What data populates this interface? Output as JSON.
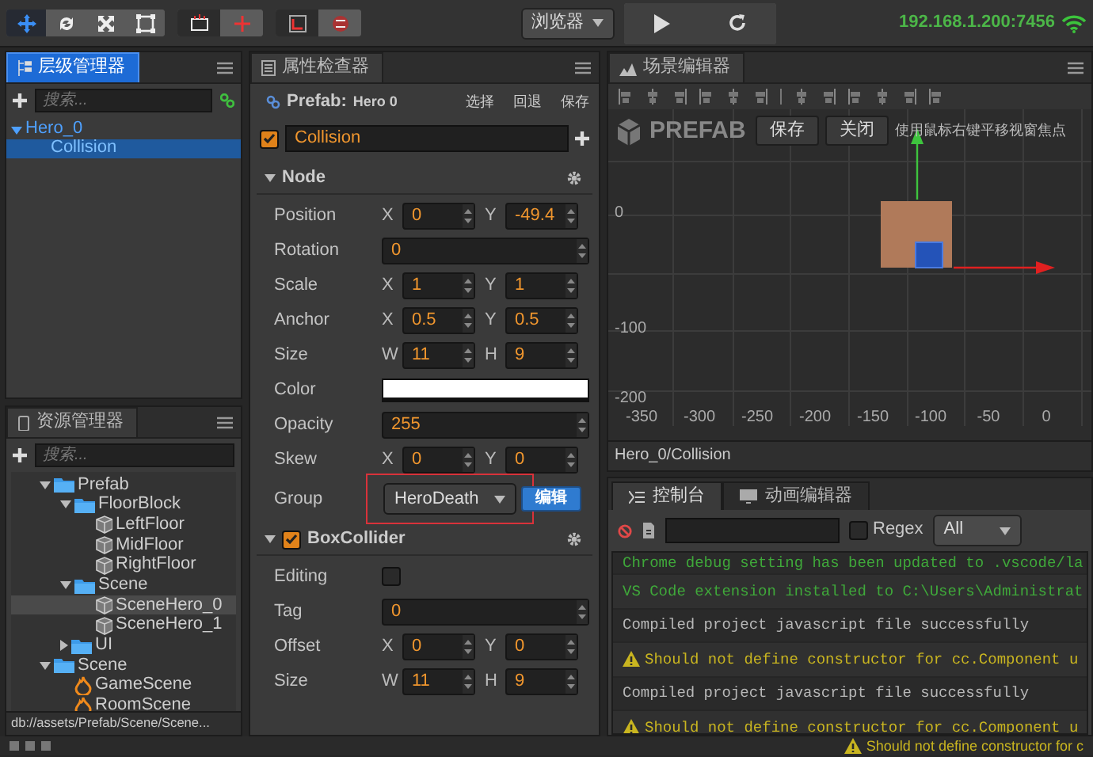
{
  "toolbar": {
    "transform_tools": [
      {
        "selected": true
      },
      {
        "selected": false
      },
      {
        "selected": false
      },
      {
        "selected": false
      }
    ],
    "toggles": [
      {
        "on": false
      },
      {
        "on": true
      },
      {
        "on": false
      },
      {
        "on": true
      }
    ],
    "platform": "浏览器",
    "address": "192.168.1.200:7456"
  },
  "hierarchy": {
    "title": "层级管理器",
    "focused": true,
    "search_placeholder": "搜索...",
    "tree": [
      {
        "label": "Hero_0",
        "expanded": true,
        "selected": false,
        "children": [
          {
            "label": "Collision",
            "selected": true
          }
        ]
      }
    ]
  },
  "assets": {
    "title": "资源管理器",
    "focused": false,
    "search_placeholder": "搜索...",
    "tree": [
      {
        "label": "Prefab",
        "kind": "folder",
        "expanded": true,
        "selected": false,
        "children": [
          {
            "label": "FloorBlock",
            "kind": "folder",
            "expanded": true,
            "selected": false,
            "children": [
              {
                "label": "LeftFloor",
                "kind": "prefab",
                "selected": false
              },
              {
                "label": "MidFloor",
                "kind": "prefab",
                "selected": false
              },
              {
                "label": "RightFloor",
                "kind": "prefab",
                "selected": false
              }
            ]
          },
          {
            "label": "Scene",
            "kind": "folder",
            "expanded": true,
            "selected": false,
            "children": [
              {
                "label": "SceneHero_0",
                "kind": "prefab",
                "selected": true
              },
              {
                "label": "SceneHero_1",
                "kind": "prefab",
                "selected": false
              }
            ]
          },
          {
            "label": "UI",
            "kind": "folder",
            "expanded": false,
            "selected": false
          }
        ]
      },
      {
        "label": "Scene",
        "kind": "folder",
        "expanded": true,
        "selected": false,
        "children": [
          {
            "label": "GameScene",
            "kind": "scene",
            "selected": false
          },
          {
            "label": "RoomScene",
            "kind": "scene",
            "selected": false
          }
        ]
      }
    ],
    "path": "db://assets/Prefab/Scene/Scene..."
  },
  "inspector": {
    "title": "属性检查器",
    "focused": false,
    "prefab_label": "Prefab:",
    "prefab_name": "Hero 0",
    "prefab_actions": [
      "选择",
      "回退",
      "保存"
    ],
    "node_active": true,
    "node_name": "Collision",
    "sections": [
      {
        "title": "Node",
        "expanded": true,
        "rows": [
          {
            "kind": "pair",
            "label": "Position",
            "fields": [
              {
                "axis": "X",
                "value": "0"
              },
              {
                "axis": "Y",
                "value": "-49.4"
              }
            ]
          },
          {
            "kind": "single",
            "label": "Rotation",
            "value": "0"
          },
          {
            "kind": "pair",
            "label": "Scale",
            "fields": [
              {
                "axis": "X",
                "value": "1"
              },
              {
                "axis": "Y",
                "value": "1"
              }
            ]
          },
          {
            "kind": "pair",
            "label": "Anchor",
            "fields": [
              {
                "axis": "X",
                "value": "0.5"
              },
              {
                "axis": "Y",
                "value": "0.5"
              }
            ]
          },
          {
            "kind": "pair",
            "label": "Size",
            "fields": [
              {
                "axis": "W",
                "value": "11"
              },
              {
                "axis": "H",
                "value": "9"
              }
            ]
          },
          {
            "kind": "color",
            "label": "Color",
            "color": "#ffffff"
          },
          {
            "kind": "single",
            "label": "Opacity",
            "value": "255"
          },
          {
            "kind": "pair",
            "label": "Skew",
            "fields": [
              {
                "axis": "X",
                "value": "0"
              },
              {
                "axis": "Y",
                "value": "0"
              }
            ]
          },
          {
            "kind": "dropdown",
            "label": "Group",
            "value": "HeroDeath",
            "button": "编辑",
            "highlighted": true
          }
        ]
      },
      {
        "title": "BoxCollider",
        "expanded": true,
        "enabled": true,
        "rows": [
          {
            "kind": "checkbox",
            "label": "Editing",
            "checked": false
          },
          {
            "kind": "single",
            "label": "Tag",
            "value": "0"
          },
          {
            "kind": "pair",
            "label": "Offset",
            "fields": [
              {
                "axis": "X",
                "value": "0"
              },
              {
                "axis": "Y",
                "value": "0"
              }
            ]
          },
          {
            "kind": "pair",
            "label": "Size",
            "fields": [
              {
                "axis": "W",
                "value": "11"
              },
              {
                "axis": "H",
                "value": "9"
              }
            ]
          }
        ]
      }
    ]
  },
  "scene": {
    "title": "场景编辑器",
    "focused": false,
    "banner": "PREFAB",
    "buttons": [
      "保存",
      "关闭"
    ],
    "hint": "使用鼠标右键平移视窗焦点",
    "y_labels": [
      "0",
      "-100",
      "-200"
    ],
    "x_labels": [
      "-350",
      "-300",
      "-250",
      "-200",
      "-150",
      "-100",
      "-50",
      "0"
    ],
    "path": "Hero_0/Collision"
  },
  "console": {
    "tabs": [
      {
        "label": "控制台",
        "selected": true
      },
      {
        "label": "动画编辑器",
        "selected": false
      }
    ],
    "regex_label": "Regex",
    "regex_checked": false,
    "level": "All",
    "logs": [
      {
        "kind": "success",
        "text": "Chrome debug setting has been updated to .vscode/la"
      },
      {
        "kind": "success",
        "text": "VS Code extension installed to C:\\Users\\Administrat"
      },
      {
        "kind": "log",
        "text": "Compiled project javascript file successfully"
      },
      {
        "kind": "warning",
        "text": "Should not define constructor for cc.Component u"
      },
      {
        "kind": "log",
        "text": "Compiled project javascript file successfully"
      },
      {
        "kind": "warning",
        "text": "Should not define constructor for cc.Component u"
      }
    ]
  },
  "status_bar": {
    "kind": "warning",
    "text": "Should not define constructor for c"
  }
}
